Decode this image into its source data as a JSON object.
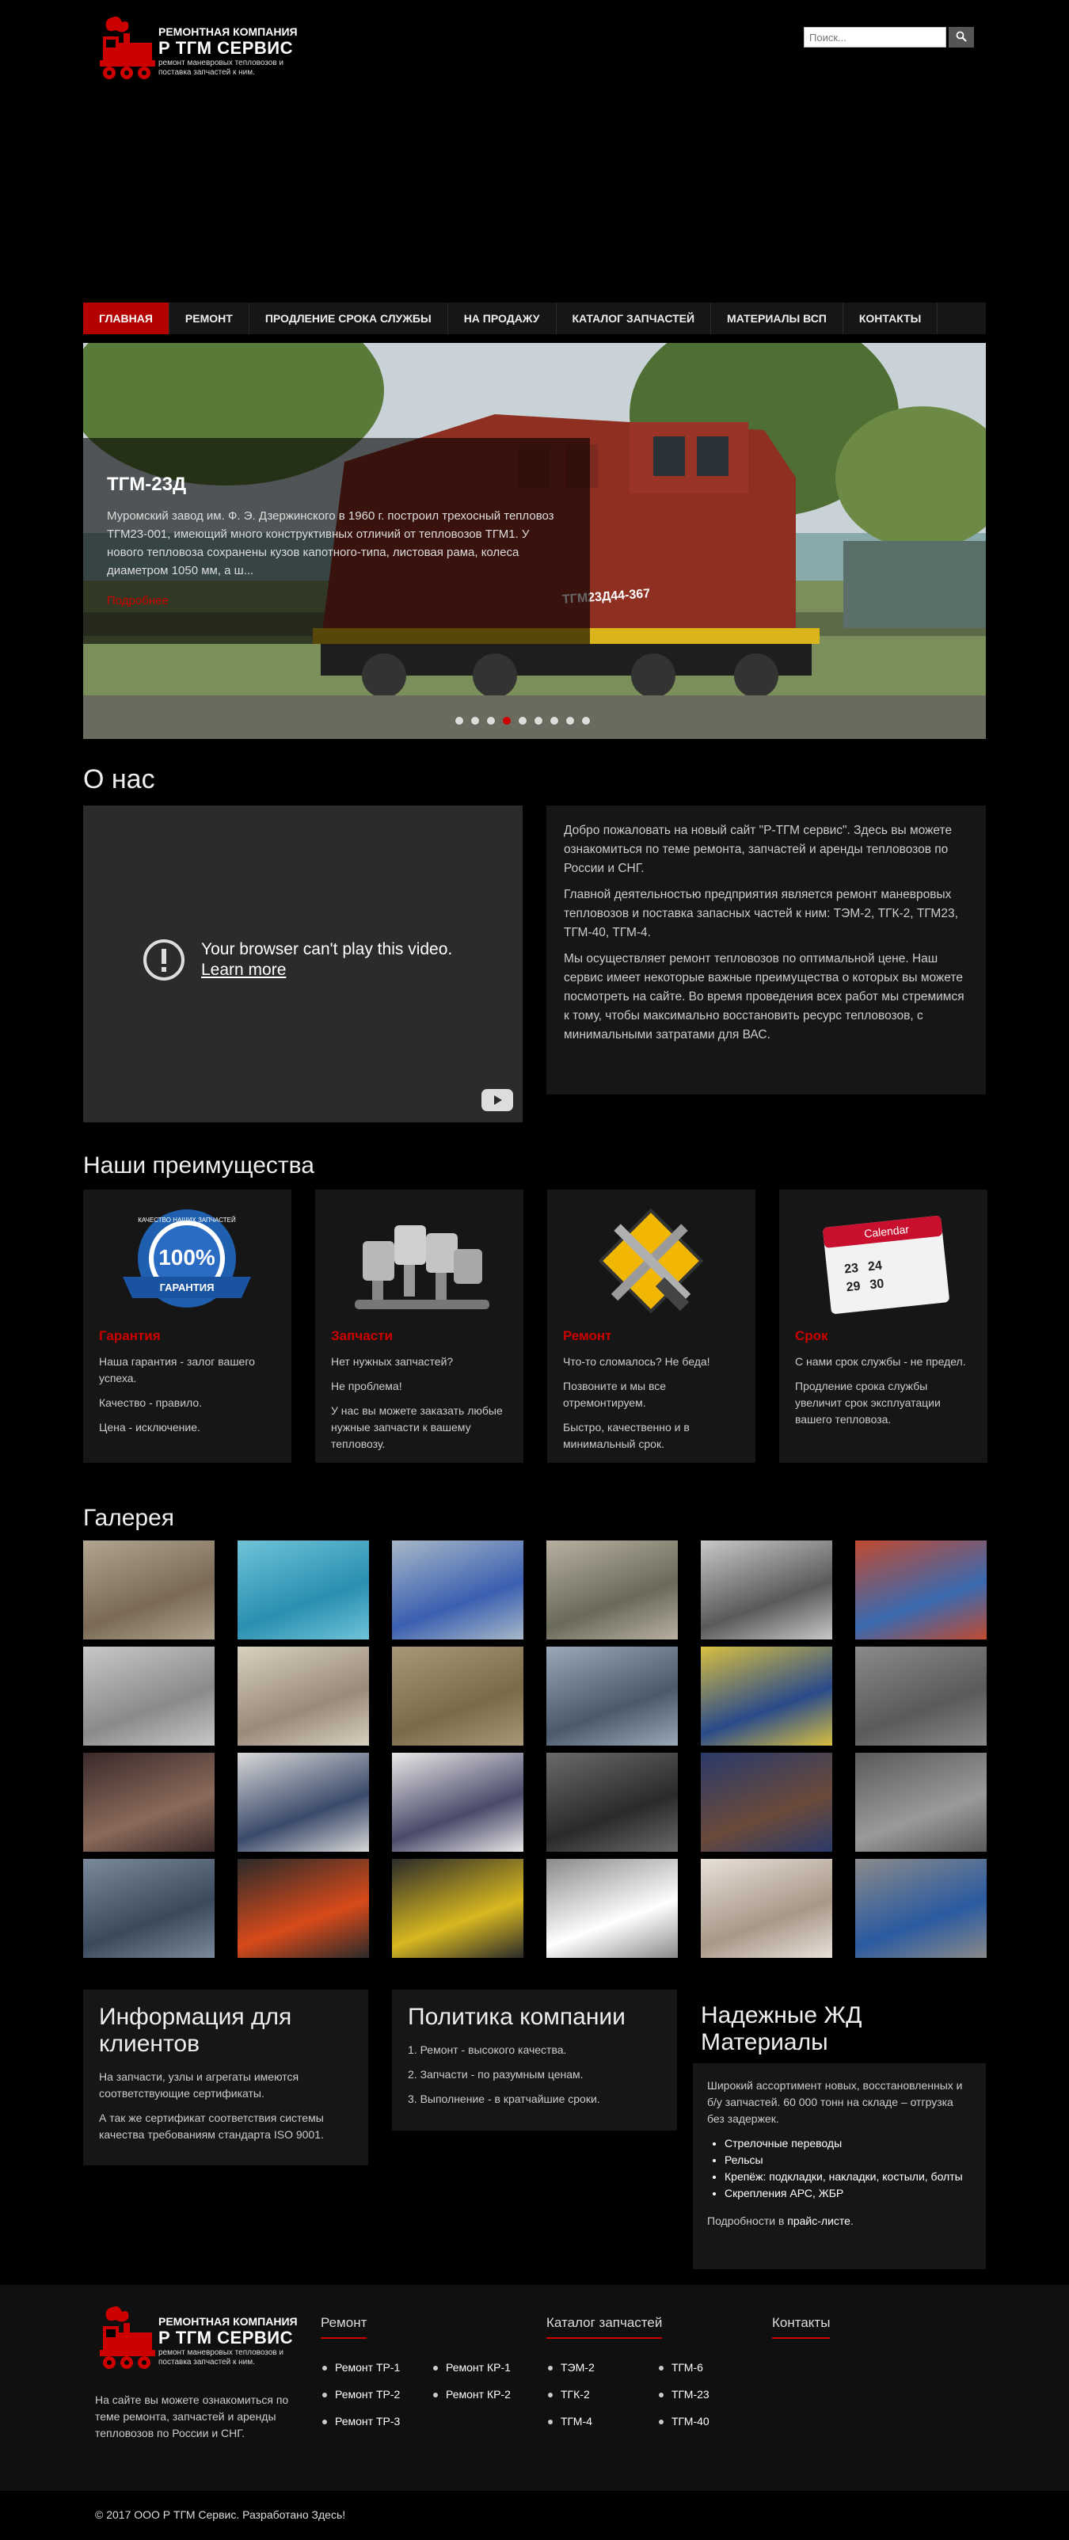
{
  "header": {
    "logo_line1": "РЕМОНТНАЯ КОМПАНИЯ",
    "logo_line2": "Р ТГМ СЕРВИС",
    "logo_line3a": "ремонт маневровых тепловозов и",
    "logo_line3b": "поставка запчастей к ним.",
    "search_placeholder": "Поиск..."
  },
  "nav": {
    "items": [
      "Главная",
      "Ремонт",
      "Продление срока службы",
      "На продажу",
      "Каталог запчастей",
      "Материалы ВСП",
      "Контакты"
    ]
  },
  "slider": {
    "title": "ТГМ-23Д",
    "text": "Муромский завод им. Ф. Э. Дзержинского в 1960 г. построил трехосный тепловоз ТГМ23-001, имеющий много конструктивных отличий от тепловозов ТГМ1. У нового тепловоза сохранены кузов капотного-типа, листовая рама, колеса диаметром 1050 мм, а ш...",
    "more": "Подробнее",
    "locomotive_label": "ТГМ23Д44-367",
    "dot_count": 9,
    "active_dot": 3
  },
  "about": {
    "title": "О нас",
    "video_message": "Your browser can't play this video.",
    "video_link": "Learn more",
    "p1": "Добро пожаловать на новый сайт \"Р-ТГМ сервис\". Здесь вы можете ознакомиться по теме ремонта, запчастей и аренды тепловозов по России и СНГ.",
    "p2": "Главной деятельностью предприятия является ремонт маневровых тепловозов и поставка запасных частей к ним: ТЭМ-2, ТГК-2, ТГМ23, ТГМ-40, ТГМ-4.",
    "p3": "Мы осуществляет ремонт тепловозов по оптимальной цене. Наш сервис имеет некоторые важные преимущества о которых вы можете посмотреть на сайте. Во время проведения всех работ мы стремимся к тому, чтобы максимально восстановить ресурс тепловозов, с минимальными затратами для ВАС."
  },
  "advantages": {
    "title": "Наши преимущества",
    "cards": [
      {
        "title": "Гарантия",
        "lines": [
          "Наша гарантия - залог вашего успеха.",
          "Качество - правило.",
          "Цена - исключение."
        ],
        "badge_top": "КАЧЕСТВО НАШИХ ЗАПЧАСТЕЙ",
        "badge_num": "100%",
        "badge_ribbon": "ГАРАНТИЯ"
      },
      {
        "title": "Запчасти",
        "lines": [
          "Нет нужных запчастей?",
          "Не проблема!",
          "У нас вы можете заказать любые нужные запчасти к вашему тепловозу."
        ]
      },
      {
        "title": "Ремонт",
        "lines": [
          "Что-то сломалось? Не беда!",
          "Позвоните и мы все отремонтируем.",
          "Быстро, качественно и в минимальный срок."
        ]
      },
      {
        "title": "Срок",
        "lines": [
          "С нами срок службы - не предел.",
          "Продление срока службы увеличит срок эксплуатации вашего тепловоза."
        ],
        "calendar_label": "Calendar",
        "calendar_nums": [
          "23",
          "24",
          "29",
          "30"
        ]
      }
    ]
  },
  "gallery": {
    "title": "Галерея",
    "count": 24
  },
  "info": {
    "clients_title": "Информация для клиентов",
    "clients_p1": "На запчасти, узлы и агрегаты имеются соответствующие сертификаты.",
    "clients_p2": "А так же сертификат соответствия системы качества требованиям стандарта ISO 9001.",
    "policy_title": "Политика компании",
    "policy_items": [
      "1. Ремонт - высокого качества.",
      "2. Запчасти - по разумным ценам.",
      "3. Выполнение - в кратчайшие сроки."
    ],
    "materials_title": "Надежные ЖД Материалы",
    "materials_p": "Широкий ассортимент новых, восстановленных и б/у запчастей. 60 000 тонн на складе – отгрузка без задержек.",
    "materials_items": [
      "Стрелочные переводы",
      "Рельсы",
      "Крепёж: подкладки, накладки, костыли, болты",
      "Скрепления АРС, ЖБР"
    ],
    "materials_more_prefix": "Подробности в ",
    "materials_more_link": "прайс-листе",
    "materials_more_suffix": "."
  },
  "footer": {
    "desc": "На сайте вы можете ознакомиться по теме ремонта, запчастей и аренды тепловозов по России и СНГ.",
    "repair_head": "Ремонт",
    "repair_items": [
      "Ремонт ТР-1",
      "Ремонт КР-1",
      "Ремонт ТР-2",
      "Ремонт КР-2",
      "Ремонт ТР-3"
    ],
    "catalog_head": "Каталог запчастей",
    "catalog_items": [
      "ТЭМ-2",
      "ТГМ-6",
      "ТГК-2",
      "ТГМ-23",
      "ТГМ-4",
      "ТГМ-40"
    ],
    "contacts_head": "Контакты",
    "copyright": "© 2017 ООО Р ТГМ Сервис. Разработано Здесь!"
  },
  "colors": {
    "accent": "#b30000",
    "background": "#000000",
    "panel": "#161616"
  }
}
